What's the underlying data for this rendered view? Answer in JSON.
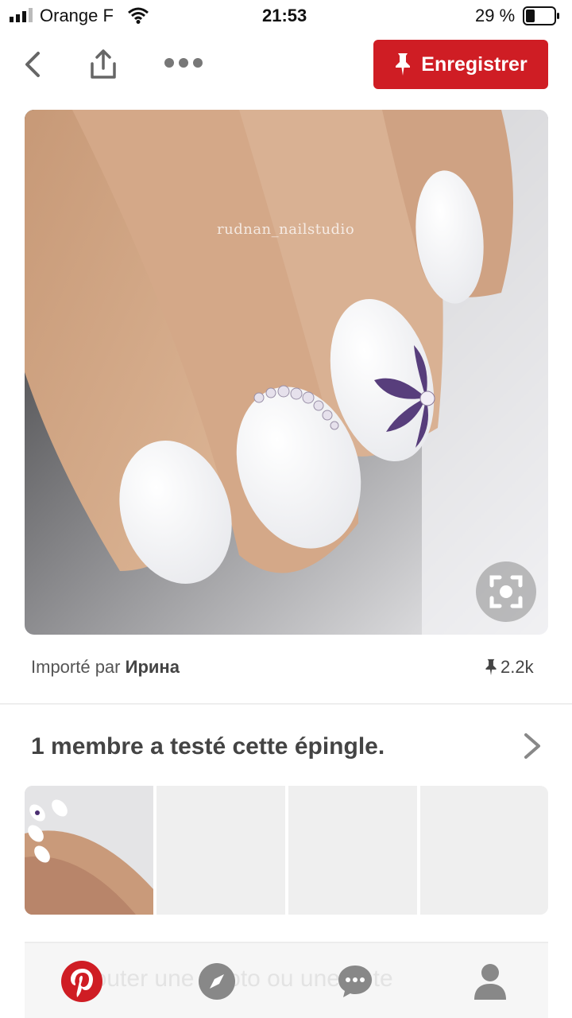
{
  "status_bar": {
    "carrier": "Orange F",
    "time": "21:53",
    "battery": "29 %",
    "icons": [
      "signal-icon",
      "wifi-icon",
      "battery-icon"
    ]
  },
  "toolbar": {
    "icons": [
      "back-chevron-icon",
      "share-icon",
      "more-icon"
    ],
    "save_label": "Enregistrer",
    "save_color": "#cf1d24"
  },
  "pin": {
    "watermark": "rudnan_nailstudio",
    "imported_prefix": "Importé par",
    "author": "Ирина",
    "saves": "2.2k"
  },
  "tried": {
    "heading": "1 membre a testé cette épingle."
  },
  "bottom_nav": {
    "ghost_text": "Ajouter une photo ou une note",
    "items": [
      "pinterest-home-icon",
      "explore-compass-icon",
      "messages-icon",
      "profile-icon"
    ]
  }
}
